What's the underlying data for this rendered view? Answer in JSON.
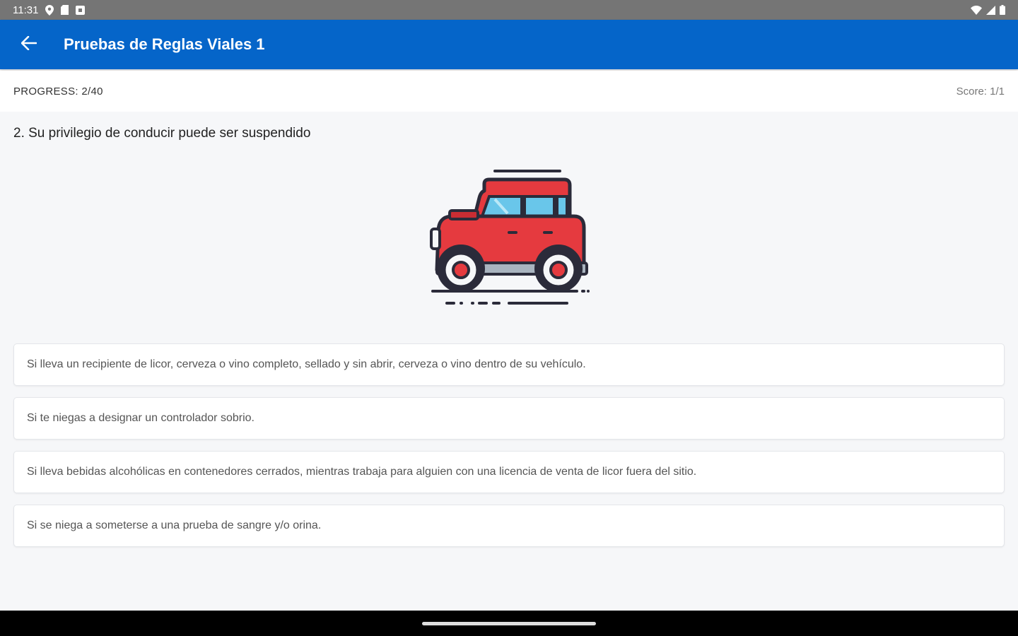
{
  "status_bar": {
    "time": "11:31",
    "icons_left": [
      "location-icon",
      "sd-card-icon",
      "notification-icon"
    ],
    "icons_right": [
      "wifi-icon",
      "signal-icon",
      "battery-icon"
    ]
  },
  "app_bar": {
    "back_icon": "arrow-back-icon",
    "title": "Pruebas de Reglas Viales 1",
    "color": "#0565c9"
  },
  "progress": {
    "label": "PROGRESS: 2/40",
    "score": "Score: 1/1"
  },
  "question": {
    "text": "2. Su privilegio de conducir puede ser suspendido",
    "image": "red-jeep-car-icon"
  },
  "options": [
    {
      "text": "Si lleva un recipiente de licor, cerveza o vino completo, sellado y sin abrir, cerveza o vino dentro de su vehículo."
    },
    {
      "text": "Si te niegas a designar un controlador sobrio."
    },
    {
      "text": "Si lleva bebidas alcohólicas en contenedores cerrados, mientras trabaja para alguien con una licencia de venta de licor fuera del sitio."
    },
    {
      "text": "Si se niega a someterse a una prueba de sangre y/o orina."
    }
  ]
}
